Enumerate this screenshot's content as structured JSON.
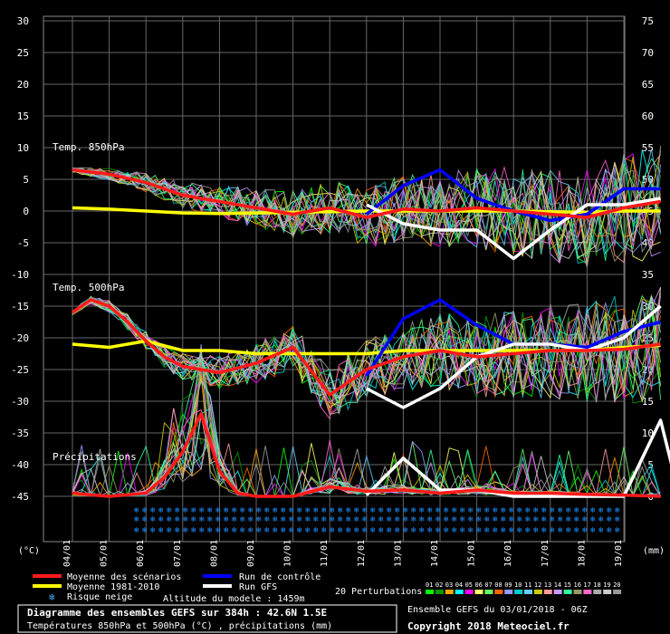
{
  "chart_data": {
    "type": "line",
    "left_axis": {
      "unit_label": "(°C)",
      "ticks": [
        30,
        25,
        20,
        15,
        10,
        5,
        0,
        -5,
        -10,
        -15,
        -20,
        -25,
        -30,
        -35,
        -40,
        -45
      ],
      "range": [
        -45,
        30
      ]
    },
    "right_axis": {
      "unit_label": "(mm)",
      "ticks": [
        75,
        70,
        65,
        60,
        55,
        50,
        45,
        40,
        35,
        30,
        25,
        20,
        15,
        10,
        5,
        0
      ],
      "range": [
        0,
        75
      ]
    },
    "x_labels": [
      "04/01",
      "05/01",
      "06/01",
      "07/01",
      "08/01",
      "09/01",
      "10/01",
      "11/01",
      "12/01",
      "13/01",
      "14/01",
      "15/01",
      "16/01",
      "17/01",
      "18/01",
      "19/01"
    ],
    "x_range_days": [
      0,
      16
    ],
    "panel_labels": {
      "t850": "Temp. 850hPa",
      "t500": "Temp. 500hPa",
      "precip": "Précipitations"
    },
    "series": [
      {
        "name": "Moyenne des scénarios",
        "color": "#ff1a1a",
        "t850": [
          [
            0,
            6.5
          ],
          [
            1,
            5.8
          ],
          [
            2,
            4.5
          ],
          [
            3,
            2.5
          ],
          [
            4,
            1.5
          ],
          [
            5,
            0.5
          ],
          [
            6,
            -0.5
          ],
          [
            7,
            0.5
          ],
          [
            8,
            -1
          ],
          [
            9,
            0.3
          ],
          [
            10,
            0
          ],
          [
            11,
            0.5
          ],
          [
            12,
            0
          ],
          [
            13,
            -0.5
          ],
          [
            14,
            -1
          ],
          [
            15,
            0.5
          ],
          [
            16,
            1.5
          ]
        ],
        "t500": [
          [
            0,
            -16
          ],
          [
            0.5,
            -14
          ],
          [
            1,
            -15
          ],
          [
            1.5,
            -17.5
          ],
          [
            2,
            -20.5
          ],
          [
            2.5,
            -23
          ],
          [
            3,
            -24.5
          ],
          [
            4,
            -25.5
          ],
          [
            5,
            -24
          ],
          [
            6,
            -21.5
          ],
          [
            7,
            -29
          ],
          [
            8,
            -25
          ],
          [
            9,
            -23
          ],
          [
            10,
            -22
          ],
          [
            11,
            -23
          ],
          [
            12,
            -22.5
          ],
          [
            13,
            -22
          ],
          [
            14,
            -22
          ],
          [
            15,
            -21.8
          ],
          [
            16,
            -21
          ]
        ],
        "precip": [
          [
            0,
            0.5
          ],
          [
            1,
            0
          ],
          [
            2,
            0.5
          ],
          [
            2.5,
            3
          ],
          [
            3,
            7
          ],
          [
            3.5,
            13
          ],
          [
            4,
            4
          ],
          [
            4.5,
            0.5
          ],
          [
            5,
            0
          ],
          [
            6,
            0
          ],
          [
            7,
            1.5
          ],
          [
            8,
            0.8
          ],
          [
            9,
            1
          ],
          [
            10,
            0.5
          ],
          [
            11,
            1
          ],
          [
            12,
            0.5
          ],
          [
            13,
            0.5
          ],
          [
            14,
            0.3
          ],
          [
            15,
            0.2
          ],
          [
            16,
            0
          ]
        ]
      },
      {
        "name": "Moyenne 1981-2010",
        "color": "#ffff00",
        "t850": [
          [
            0,
            0.5
          ],
          [
            1,
            0.3
          ],
          [
            2,
            0
          ],
          [
            3,
            -0.3
          ],
          [
            4,
            -0.4
          ],
          [
            5,
            -0.3
          ],
          [
            6,
            -0.2
          ],
          [
            7,
            -0.1
          ],
          [
            8,
            0
          ],
          [
            9,
            0
          ],
          [
            10,
            0
          ],
          [
            11,
            0
          ],
          [
            12,
            0
          ],
          [
            13,
            -0.1
          ],
          [
            14,
            -0.2
          ],
          [
            15,
            0
          ],
          [
            16,
            0
          ]
        ],
        "t500": [
          [
            0,
            -21
          ],
          [
            1,
            -21.5
          ],
          [
            2,
            -20.5
          ],
          [
            3,
            -22
          ],
          [
            4,
            -22
          ],
          [
            5,
            -22.5
          ],
          [
            6,
            -22.5
          ],
          [
            7,
            -22.5
          ],
          [
            8,
            -22.5
          ],
          [
            9,
            -22
          ],
          [
            10,
            -22
          ],
          [
            11,
            -22
          ],
          [
            12,
            -22
          ],
          [
            13,
            -22
          ],
          [
            14,
            -22
          ],
          [
            15,
            -21.5
          ],
          [
            16,
            -21.2
          ]
        ]
      },
      {
        "name": "Run de contrôle",
        "color": "#0000ff",
        "t850": [
          [
            8,
            -0.5
          ],
          [
            9,
            4
          ],
          [
            10,
            6.5
          ],
          [
            11,
            2
          ],
          [
            12,
            0
          ],
          [
            13,
            -1.5
          ],
          [
            14,
            -0.5
          ],
          [
            15,
            3.5
          ],
          [
            16,
            3.5
          ]
        ],
        "t500": [
          [
            8,
            -26
          ],
          [
            9,
            -17
          ],
          [
            10,
            -14
          ],
          [
            11,
            -18
          ],
          [
            12,
            -21
          ],
          [
            13,
            -21
          ],
          [
            14,
            -21.5
          ],
          [
            15,
            -19
          ],
          [
            16,
            -17.5
          ]
        ]
      },
      {
        "name": "Run GFS",
        "color": "#ffffff",
        "t850": [
          [
            8,
            1
          ],
          [
            9,
            -2
          ],
          [
            10,
            -3
          ],
          [
            11,
            -3
          ],
          [
            12,
            -7.5
          ],
          [
            13,
            -3
          ],
          [
            14,
            1
          ],
          [
            15,
            1
          ],
          [
            16,
            2
          ]
        ],
        "t500": [
          [
            8,
            -28
          ],
          [
            9,
            -31
          ],
          [
            10,
            -28
          ],
          [
            11,
            -23
          ],
          [
            12,
            -21
          ],
          [
            13,
            -21
          ],
          [
            14,
            -22
          ],
          [
            15,
            -20
          ],
          [
            16,
            -15
          ]
        ],
        "precip": [
          [
            8,
            0.2
          ],
          [
            9,
            6
          ],
          [
            10,
            1
          ],
          [
            11,
            1
          ],
          [
            12,
            0
          ],
          [
            13,
            0
          ],
          [
            14,
            0
          ],
          [
            15,
            0
          ],
          [
            16,
            12
          ],
          [
            16.3,
            5
          ]
        ]
      }
    ],
    "perturbation_count": 20,
    "perturbation_codes": [
      "01",
      "02",
      "03",
      "04",
      "05",
      "06",
      "07",
      "08",
      "09",
      "10",
      "11",
      "12",
      "13",
      "14",
      "15",
      "16",
      "17",
      "18",
      "19",
      "20"
    ],
    "perturbation_colors": [
      "#00ff00",
      "#009900",
      "#ffa500",
      "#00ffff",
      "#ff00ff",
      "#ffff66",
      "#66ff66",
      "#ff6600",
      "#9999ff",
      "#00cccc",
      "#66ccff",
      "#cccc00",
      "#ff9999",
      "#cc99ff",
      "#33ff99",
      "#999966",
      "#ff66cc",
      "#aaaaaa",
      "#cccccc",
      "#999999"
    ]
  },
  "legend": {
    "mean_scenarios": "Moyenne des scénarios",
    "mean_1981_2010": "Moyenne 1981-2010",
    "snow_risk": "Risque neige",
    "control_run": "Run de contrôle",
    "gfs_run": "Run GFS",
    "model_altitude": "Altitude du modele : 1459m",
    "perturbations": "20 Perturbations",
    "snow_icon": "snowflake-icon"
  },
  "footer": {
    "title": "Diagramme des ensembles GEFS sur 384h : 42.6N 1.5E",
    "subtitle": "Températures 850hPa et 500hPa (°C) , précipitations (mm)",
    "ensemble_run": "Ensemble GEFS du 03/01/2018 - 06Z",
    "copyright": "Copyright 2018 Meteociel.fr"
  },
  "colors": {
    "background": "#000000",
    "grid": "#777777",
    "text": "#ffffff"
  }
}
